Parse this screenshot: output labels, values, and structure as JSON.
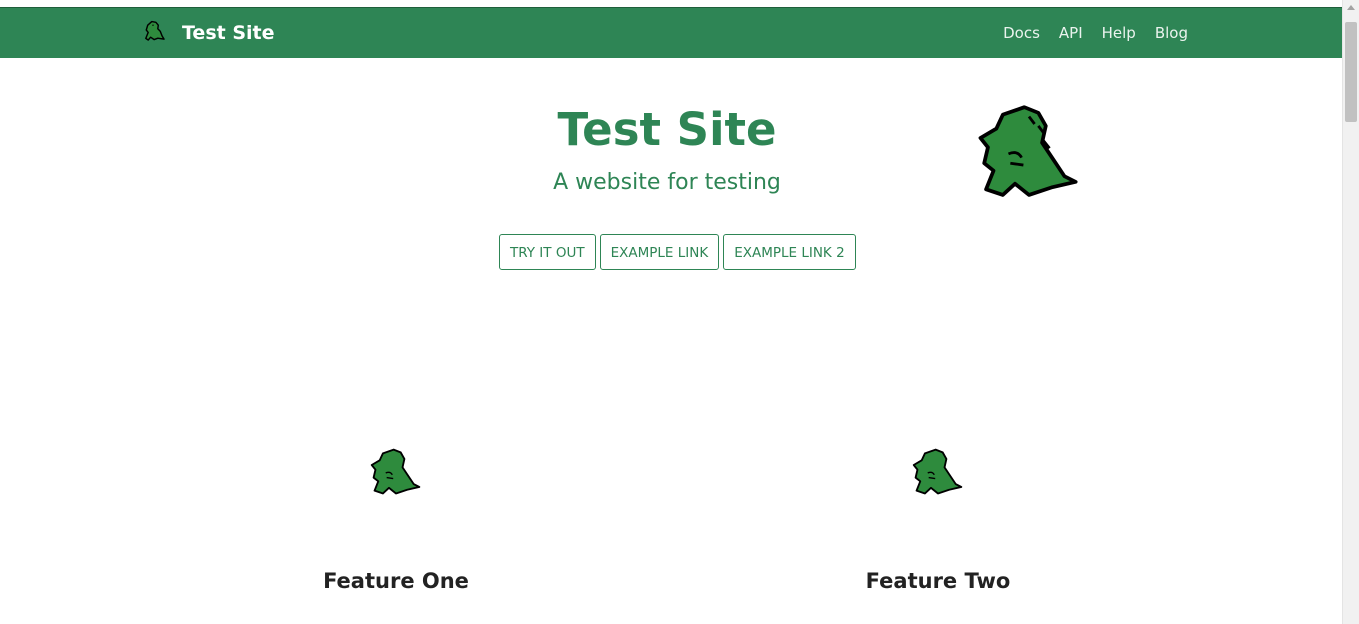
{
  "brand": {
    "title": "Test Site",
    "logo_icon": "dinosaur-icon"
  },
  "nav": {
    "items": [
      {
        "label": "Docs"
      },
      {
        "label": "API"
      },
      {
        "label": "Help"
      },
      {
        "label": "Blog"
      }
    ]
  },
  "hero": {
    "title": "Test Site",
    "tagline": "A website for testing",
    "logo_icon": "dinosaur-icon",
    "buttons": [
      {
        "label": "TRY IT OUT"
      },
      {
        "label": "EXAMPLE LINK"
      },
      {
        "label": "EXAMPLE LINK 2"
      }
    ]
  },
  "features": [
    {
      "title": "Feature One",
      "icon": "dinosaur-icon"
    },
    {
      "title": "Feature Two",
      "icon": "dinosaur-icon"
    }
  ],
  "colors": {
    "primary": "#2e8555",
    "dino_fill": "#2e8b3d",
    "heading_dark": "#222222"
  }
}
